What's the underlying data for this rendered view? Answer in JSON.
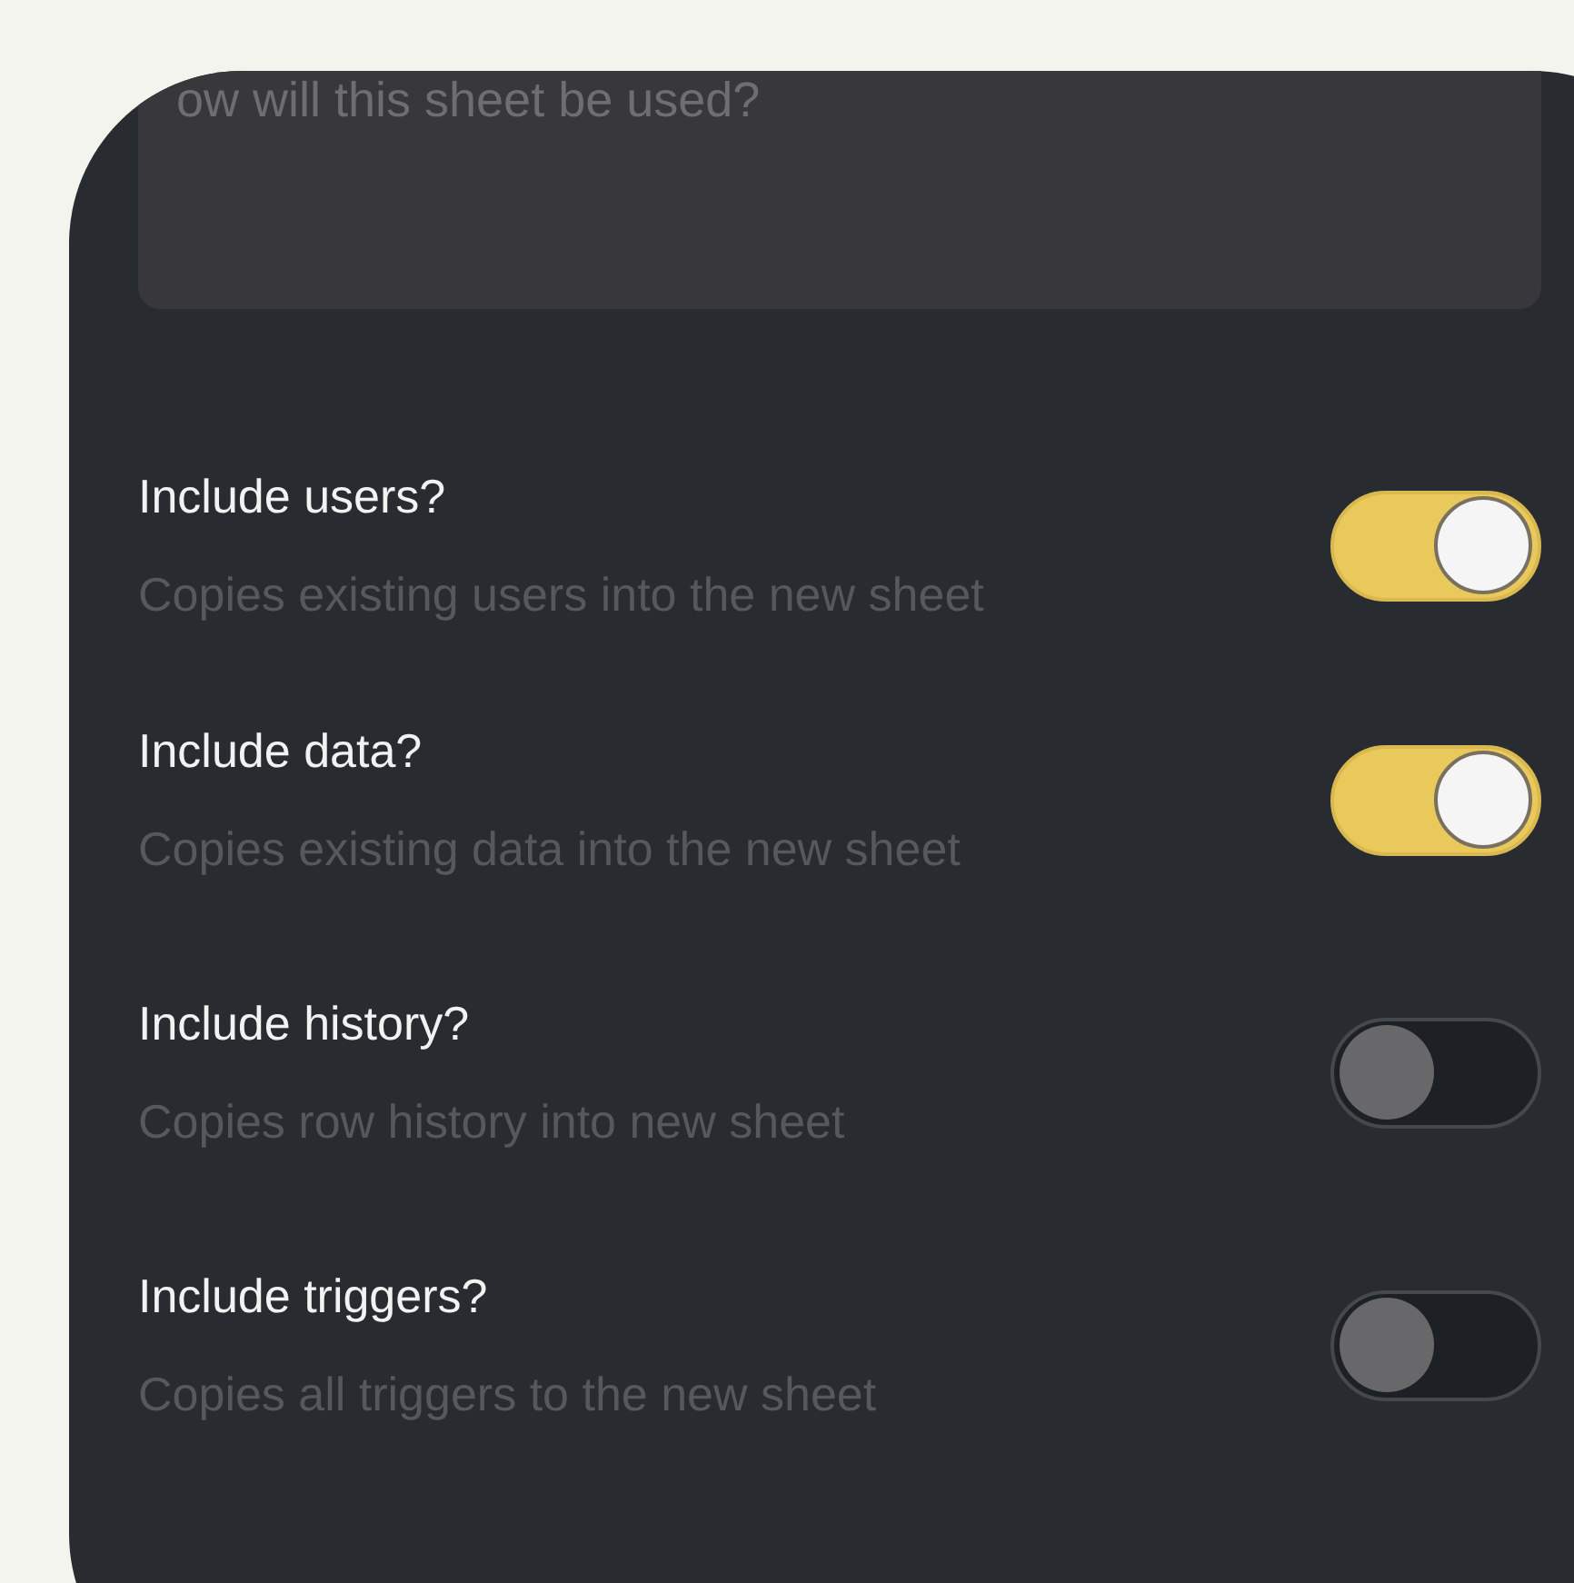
{
  "usage_field": {
    "placeholder": "ow will this sheet be used?"
  },
  "options": [
    {
      "title": "Include users?",
      "description": "Copies existing users into the new sheet",
      "on": true
    },
    {
      "title": "Include data?",
      "description": "Copies existing data into the new sheet",
      "on": true
    },
    {
      "title": "Include history?",
      "description": "Copies row history into new sheet",
      "on": false
    },
    {
      "title": "Include triggers?",
      "description": "Copies all triggers to the new sheet",
      "on": false
    }
  ]
}
